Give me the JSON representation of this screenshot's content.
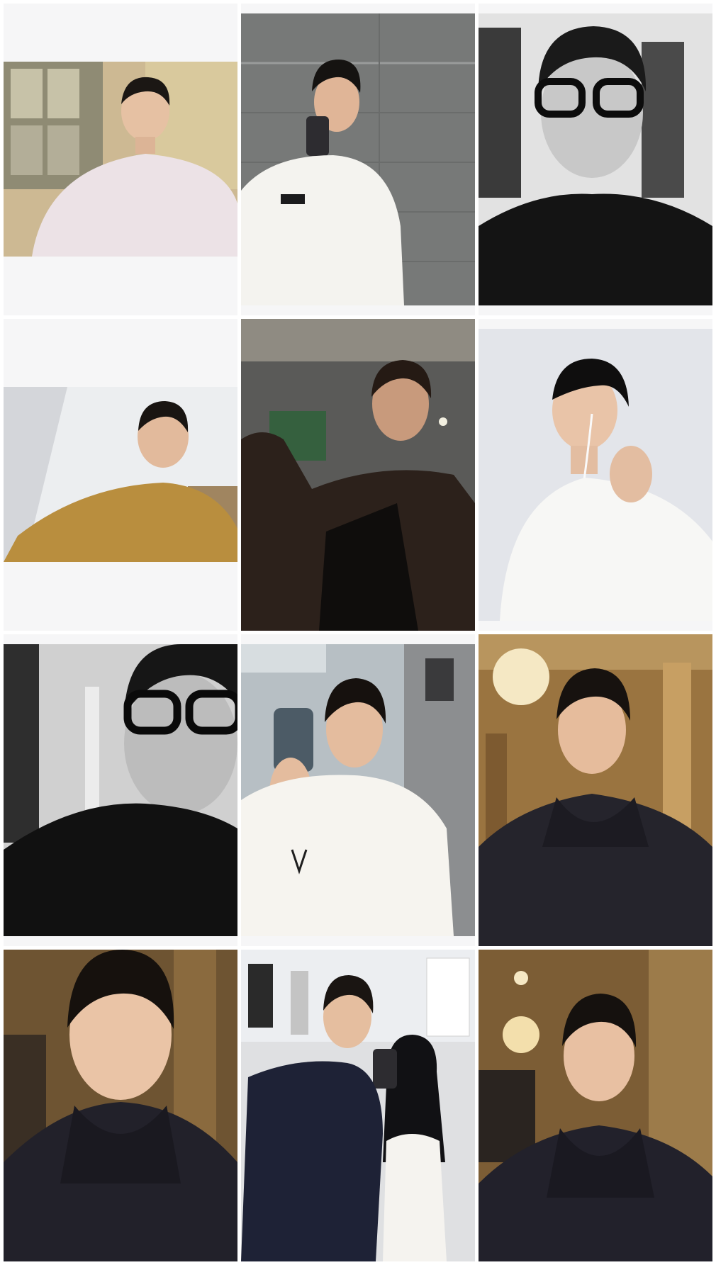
{
  "gallery": {
    "photos": [
      {
        "subject": "selfie-pink-sweater",
        "palette": {
          "bg": "#c9b58a",
          "shirt": "#ece2e6",
          "hair": "#1b1714"
        }
      },
      {
        "subject": "mirror-selfie-white-shirt",
        "palette": {
          "bg": "#7d7f7e",
          "shirt": "#f4f3ef",
          "hair": "#151311"
        }
      },
      {
        "subject": "bw-glasses-black-tee",
        "palette": {
          "bg": "#e8e8e8",
          "shirt": "#141414",
          "hair": "#1a1a1a"
        }
      },
      {
        "subject": "selfie-mustard-sweater",
        "palette": {
          "bg": "#e9eaec",
          "shirt": "#b98e3e",
          "hair": "#191512"
        }
      },
      {
        "subject": "leather-jacket-dim-room",
        "palette": {
          "bg": "#5a5a58",
          "shirt": "#2c211b",
          "hair": "#251a14"
        }
      },
      {
        "subject": "profile-white-shirt-earphones",
        "palette": {
          "bg": "#e4e6eb",
          "shirt": "#f7f7f5",
          "hair": "#0f0e0e"
        }
      },
      {
        "subject": "bw-glasses-closeup",
        "palette": {
          "bg": "#d4d4d4",
          "shirt": "#111111",
          "hair": "#161616"
        }
      },
      {
        "subject": "mirror-selfie-white-tee",
        "palette": {
          "bg": "#b9c2c6",
          "shirt": "#f6f4ef",
          "hair": "#16110e"
        }
      },
      {
        "subject": "palace-hoodie-selfie",
        "palette": {
          "bg": "#9a7440",
          "shirt": "#25242c",
          "hair": "#17120f"
        }
      },
      {
        "subject": "palace-hoodie-closeup",
        "palette": {
          "bg": "#6e5432",
          "shirt": "#22212a",
          "hair": "#16110d"
        }
      },
      {
        "subject": "mirror-selfie-couple",
        "palette": {
          "bg": "#dfe0e2",
          "shirt": "#1e2236",
          "hair": "#1a1512"
        }
      },
      {
        "subject": "palace-hoodie-chandelier",
        "palette": {
          "bg": "#7c5d35",
          "shirt": "#22212b",
          "hair": "#15110e"
        }
      }
    ]
  }
}
